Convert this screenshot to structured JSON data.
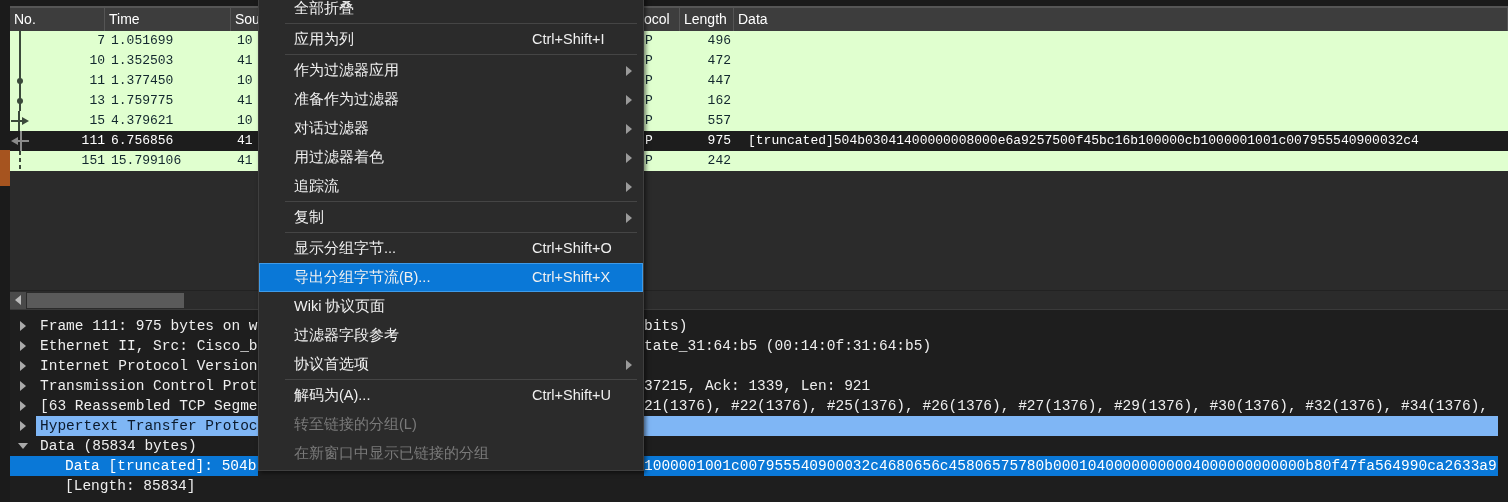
{
  "packet_list": {
    "columns": [
      "No.",
      "Time",
      "Sou",
      "ocol",
      "Length",
      "Data"
    ],
    "rows": [
      {
        "no": "7",
        "time": "1.051699",
        "source": "10",
        "protocol": "P",
        "length": "496",
        "selected": false,
        "kind": "line"
      },
      {
        "no": "10",
        "time": "1.352503",
        "source": "41",
        "protocol": "P",
        "length": "472",
        "selected": false,
        "kind": "line"
      },
      {
        "no": "11",
        "time": "1.377450",
        "source": "10",
        "protocol": "P",
        "length": "447",
        "selected": false,
        "kind": "dot"
      },
      {
        "no": "13",
        "time": "1.759775",
        "source": "41",
        "protocol": "P",
        "length": "162",
        "selected": false,
        "kind": "dot"
      },
      {
        "no": "15",
        "time": "4.379621",
        "source": "10",
        "protocol": "P",
        "length": "557",
        "selected": false,
        "kind": "arrowright"
      },
      {
        "no": "111",
        "time": "6.756856",
        "source": "41",
        "protocol": "P",
        "length": "975",
        "data": "[truncated]504b03041400000008000e6a9257500f45bc16b100000cb1000001001c007955540900032c4",
        "selected": true,
        "kind": "arrowleft"
      },
      {
        "no": "151",
        "time": "15.799106",
        "source": "41",
        "protocol": "P",
        "length": "242",
        "selected": false,
        "kind": "dash"
      }
    ]
  },
  "details_tree": [
    {
      "left": "Frame 111: 975 bytes on w",
      "right": "bits)",
      "expanded": false,
      "selected": false,
      "highlighted": false
    },
    {
      "left": "Ethernet II, Src: Cisco_b",
      "right": "tate_31:64:b5 (00:14:0f:31:64:b5)",
      "expanded": false,
      "selected": false,
      "highlighted": false
    },
    {
      "left": "Internet Protocol Version",
      "expanded": false,
      "selected": false,
      "highlighted": false
    },
    {
      "left": "Transmission Control Prot",
      "right": "37215, Ack: 1339, Len: 921",
      "expanded": false,
      "selected": false,
      "highlighted": false
    },
    {
      "left": "[63 Reassembled TCP Segme",
      "right": "21(1376), #22(1376), #25(1376), #26(1376), #27(1376), #29(1376), #30(1376), #32(1376), #34(1376),",
      "expanded": false,
      "selected": false,
      "highlighted": false
    },
    {
      "left": "Hypertext Transfer Protoc",
      "expanded": false,
      "selected": false,
      "highlighted": true
    },
    {
      "left": "Data (85834 bytes)",
      "expanded": true,
      "selected": false,
      "highlighted": false,
      "children": [
        {
          "left": "Data [truncated]: 504b",
          "right": "1000001001c007955540900032c4680656c45806575780b00010400000000004000000000000b80f47fa564990ca2633a9",
          "selected": true,
          "highlighted": false
        },
        {
          "left": "[Length: 85834]",
          "selected": false,
          "highlighted": false
        }
      ]
    }
  ],
  "context_menu": [
    {
      "kind": "item",
      "label": "全部折叠",
      "submenu": false,
      "disabled": false,
      "selected": false
    },
    {
      "kind": "separator"
    },
    {
      "kind": "item",
      "label": "应用为列",
      "shortcut": "Ctrl+Shift+I",
      "submenu": false,
      "disabled": false,
      "selected": false
    },
    {
      "kind": "separator"
    },
    {
      "kind": "item",
      "label": "作为过滤器应用",
      "submenu": true,
      "disabled": false,
      "selected": false
    },
    {
      "kind": "item",
      "label": "准备作为过滤器",
      "submenu": true,
      "disabled": false,
      "selected": false
    },
    {
      "kind": "item",
      "label": "对话过滤器",
      "submenu": true,
      "disabled": false,
      "selected": false
    },
    {
      "kind": "item",
      "label": "用过滤器着色",
      "submenu": true,
      "disabled": false,
      "selected": false
    },
    {
      "kind": "item",
      "label": "追踪流",
      "submenu": true,
      "disabled": false,
      "selected": false
    },
    {
      "kind": "separator"
    },
    {
      "kind": "item",
      "label": "复制",
      "submenu": true,
      "disabled": false,
      "selected": false
    },
    {
      "kind": "separator"
    },
    {
      "kind": "item",
      "label": "显示分组字节...",
      "shortcut": "Ctrl+Shift+O",
      "submenu": false,
      "disabled": false,
      "selected": false
    },
    {
      "kind": "item",
      "label": "导出分组字节流(B)...",
      "shortcut": "Ctrl+Shift+X",
      "submenu": false,
      "disabled": false,
      "selected": true
    },
    {
      "kind": "item",
      "label": "Wiki 协议页面",
      "submenu": false,
      "disabled": false,
      "selected": false
    },
    {
      "kind": "item",
      "label": "过滤器字段参考",
      "submenu": false,
      "disabled": false,
      "selected": false
    },
    {
      "kind": "item",
      "label": "协议首选项",
      "submenu": true,
      "disabled": false,
      "selected": false
    },
    {
      "kind": "separator"
    },
    {
      "kind": "item",
      "label": "解码为(A)...",
      "shortcut": "Ctrl+Shift+U",
      "submenu": false,
      "disabled": false,
      "selected": false
    },
    {
      "kind": "item",
      "label": "转至链接的分组(L)",
      "submenu": false,
      "disabled": true,
      "selected": false
    },
    {
      "kind": "item",
      "label": "在新窗口中显示已链接的分组",
      "submenu": false,
      "disabled": true,
      "selected": false
    }
  ]
}
